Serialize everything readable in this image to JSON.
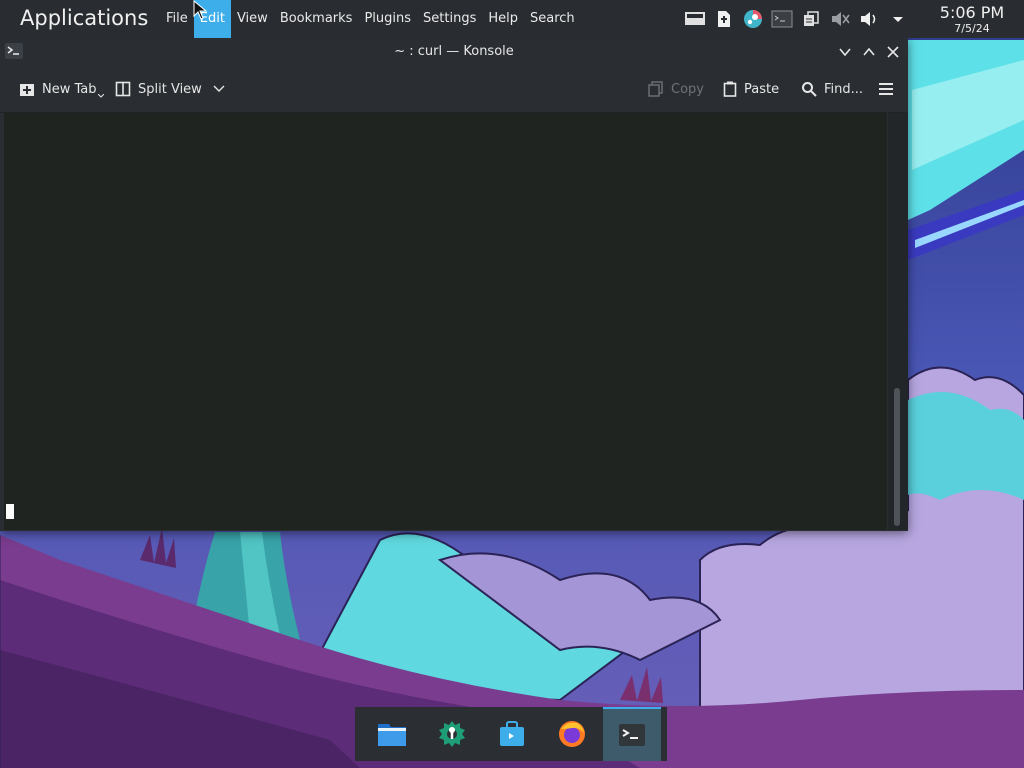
{
  "top_panel": {
    "launcher_label": "Applications",
    "global_menu": [
      {
        "label": "File"
      },
      {
        "label": "Edit",
        "active": true
      },
      {
        "label": "View"
      },
      {
        "label": "Bookmarks"
      },
      {
        "label": "Plugins"
      },
      {
        "label": "Settings"
      },
      {
        "label": "Help"
      },
      {
        "label": "Search"
      }
    ],
    "tray_icons": [
      "display-icon",
      "update-icon",
      "steam-icon",
      "terminal-tray-icon",
      "clipboard-icon",
      "volume-muted-icon",
      "volume-icon",
      "expand-tray-icon"
    ],
    "clock": {
      "time": "5:06 PM",
      "date": "7/5/24"
    }
  },
  "window": {
    "title": "~ : curl — Konsole",
    "toolbar": {
      "new_tab": "New Tab",
      "split_view": "Split View",
      "copy": "Copy",
      "paste": "Paste",
      "find": "Find..."
    }
  },
  "taskbar": {
    "items": [
      "file-manager-icon",
      "system-settings-icon",
      "discover-icon",
      "firefox-icon",
      "konsole-icon"
    ],
    "active_index": 4
  },
  "colors": {
    "accent": "#3daee9",
    "panel_bg": "#292c30",
    "window_bg": "#2a2e32",
    "terminal_bg": "#1f2421"
  }
}
